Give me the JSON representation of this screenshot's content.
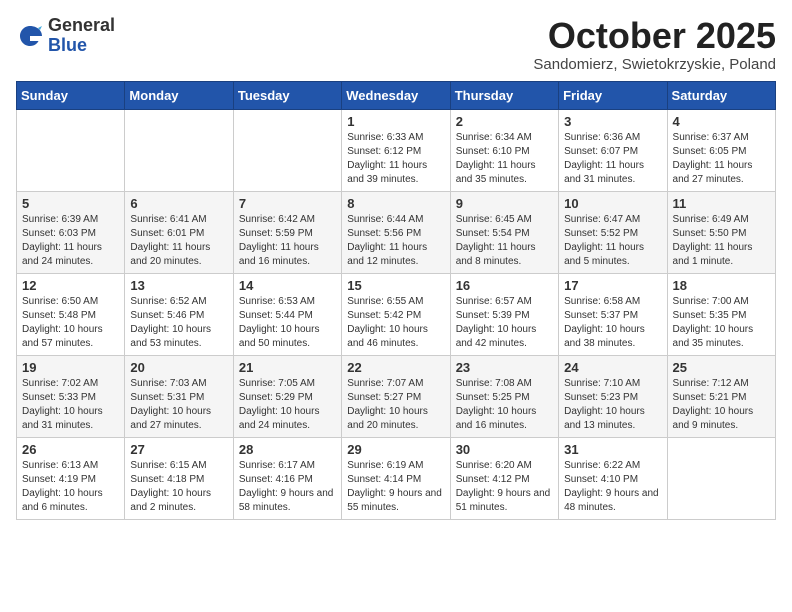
{
  "header": {
    "logo_general": "General",
    "logo_blue": "Blue",
    "month_title": "October 2025",
    "subtitle": "Sandomierz, Swietokrzyskie, Poland"
  },
  "weekdays": [
    "Sunday",
    "Monday",
    "Tuesday",
    "Wednesday",
    "Thursday",
    "Friday",
    "Saturday"
  ],
  "weeks": [
    [
      {
        "day": "",
        "info": ""
      },
      {
        "day": "",
        "info": ""
      },
      {
        "day": "",
        "info": ""
      },
      {
        "day": "1",
        "info": "Sunrise: 6:33 AM\nSunset: 6:12 PM\nDaylight: 11 hours\nand 39 minutes."
      },
      {
        "day": "2",
        "info": "Sunrise: 6:34 AM\nSunset: 6:10 PM\nDaylight: 11 hours\nand 35 minutes."
      },
      {
        "day": "3",
        "info": "Sunrise: 6:36 AM\nSunset: 6:07 PM\nDaylight: 11 hours\nand 31 minutes."
      },
      {
        "day": "4",
        "info": "Sunrise: 6:37 AM\nSunset: 6:05 PM\nDaylight: 11 hours\nand 27 minutes."
      }
    ],
    [
      {
        "day": "5",
        "info": "Sunrise: 6:39 AM\nSunset: 6:03 PM\nDaylight: 11 hours\nand 24 minutes."
      },
      {
        "day": "6",
        "info": "Sunrise: 6:41 AM\nSunset: 6:01 PM\nDaylight: 11 hours\nand 20 minutes."
      },
      {
        "day": "7",
        "info": "Sunrise: 6:42 AM\nSunset: 5:59 PM\nDaylight: 11 hours\nand 16 minutes."
      },
      {
        "day": "8",
        "info": "Sunrise: 6:44 AM\nSunset: 5:56 PM\nDaylight: 11 hours\nand 12 minutes."
      },
      {
        "day": "9",
        "info": "Sunrise: 6:45 AM\nSunset: 5:54 PM\nDaylight: 11 hours\nand 8 minutes."
      },
      {
        "day": "10",
        "info": "Sunrise: 6:47 AM\nSunset: 5:52 PM\nDaylight: 11 hours\nand 5 minutes."
      },
      {
        "day": "11",
        "info": "Sunrise: 6:49 AM\nSunset: 5:50 PM\nDaylight: 11 hours\nand 1 minute."
      }
    ],
    [
      {
        "day": "12",
        "info": "Sunrise: 6:50 AM\nSunset: 5:48 PM\nDaylight: 10 hours\nand 57 minutes."
      },
      {
        "day": "13",
        "info": "Sunrise: 6:52 AM\nSunset: 5:46 PM\nDaylight: 10 hours\nand 53 minutes."
      },
      {
        "day": "14",
        "info": "Sunrise: 6:53 AM\nSunset: 5:44 PM\nDaylight: 10 hours\nand 50 minutes."
      },
      {
        "day": "15",
        "info": "Sunrise: 6:55 AM\nSunset: 5:42 PM\nDaylight: 10 hours\nand 46 minutes."
      },
      {
        "day": "16",
        "info": "Sunrise: 6:57 AM\nSunset: 5:39 PM\nDaylight: 10 hours\nand 42 minutes."
      },
      {
        "day": "17",
        "info": "Sunrise: 6:58 AM\nSunset: 5:37 PM\nDaylight: 10 hours\nand 38 minutes."
      },
      {
        "day": "18",
        "info": "Sunrise: 7:00 AM\nSunset: 5:35 PM\nDaylight: 10 hours\nand 35 minutes."
      }
    ],
    [
      {
        "day": "19",
        "info": "Sunrise: 7:02 AM\nSunset: 5:33 PM\nDaylight: 10 hours\nand 31 minutes."
      },
      {
        "day": "20",
        "info": "Sunrise: 7:03 AM\nSunset: 5:31 PM\nDaylight: 10 hours\nand 27 minutes."
      },
      {
        "day": "21",
        "info": "Sunrise: 7:05 AM\nSunset: 5:29 PM\nDaylight: 10 hours\nand 24 minutes."
      },
      {
        "day": "22",
        "info": "Sunrise: 7:07 AM\nSunset: 5:27 PM\nDaylight: 10 hours\nand 20 minutes."
      },
      {
        "day": "23",
        "info": "Sunrise: 7:08 AM\nSunset: 5:25 PM\nDaylight: 10 hours\nand 16 minutes."
      },
      {
        "day": "24",
        "info": "Sunrise: 7:10 AM\nSunset: 5:23 PM\nDaylight: 10 hours\nand 13 minutes."
      },
      {
        "day": "25",
        "info": "Sunrise: 7:12 AM\nSunset: 5:21 PM\nDaylight: 10 hours\nand 9 minutes."
      }
    ],
    [
      {
        "day": "26",
        "info": "Sunrise: 6:13 AM\nSunset: 4:19 PM\nDaylight: 10 hours\nand 6 minutes."
      },
      {
        "day": "27",
        "info": "Sunrise: 6:15 AM\nSunset: 4:18 PM\nDaylight: 10 hours\nand 2 minutes."
      },
      {
        "day": "28",
        "info": "Sunrise: 6:17 AM\nSunset: 4:16 PM\nDaylight: 9 hours\nand 58 minutes."
      },
      {
        "day": "29",
        "info": "Sunrise: 6:19 AM\nSunset: 4:14 PM\nDaylight: 9 hours\nand 55 minutes."
      },
      {
        "day": "30",
        "info": "Sunrise: 6:20 AM\nSunset: 4:12 PM\nDaylight: 9 hours\nand 51 minutes."
      },
      {
        "day": "31",
        "info": "Sunrise: 6:22 AM\nSunset: 4:10 PM\nDaylight: 9 hours\nand 48 minutes."
      },
      {
        "day": "",
        "info": ""
      }
    ]
  ]
}
